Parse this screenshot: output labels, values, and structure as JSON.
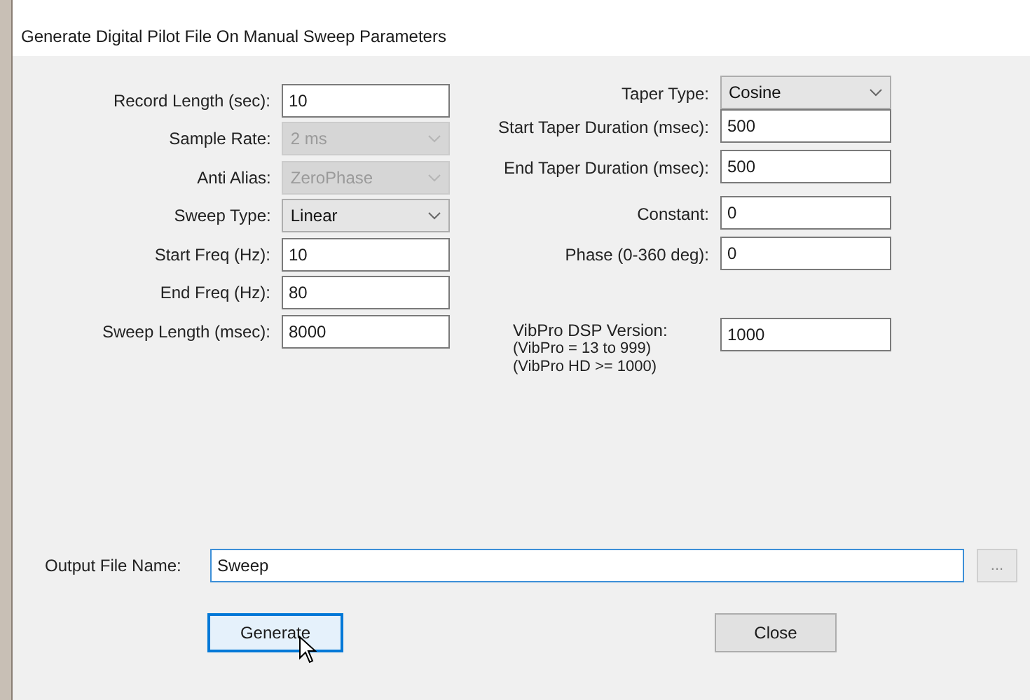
{
  "window": {
    "title": "Generate Digital Pilot File On Manual Sweep Parameters"
  },
  "left_fields": [
    {
      "label": "Record Length (sec):",
      "value": "10",
      "kind": "input",
      "disabled": false
    },
    {
      "label": "Sample Rate:",
      "value": "2 ms",
      "kind": "dropdown",
      "disabled": true
    },
    {
      "label": "Anti Alias:",
      "value": "ZeroPhase",
      "kind": "dropdown",
      "disabled": true
    },
    {
      "label": "Sweep Type:",
      "value": "Linear",
      "kind": "dropdown",
      "disabled": false
    },
    {
      "label": "Start Freq (Hz):",
      "value": "10",
      "kind": "input",
      "disabled": false
    },
    {
      "label": "End Freq (Hz):",
      "value": "80",
      "kind": "input",
      "disabled": false
    },
    {
      "label": "Sweep Length (msec):",
      "value": "8000",
      "kind": "input",
      "disabled": false
    }
  ],
  "right_fields": [
    {
      "label": "Taper Type:",
      "value": "Cosine",
      "kind": "dropdown",
      "disabled": false
    },
    {
      "label": "Start Taper Duration (msec):",
      "value": "500",
      "kind": "input",
      "disabled": false
    },
    {
      "label": "End Taper Duration (msec):",
      "value": "500",
      "kind": "input",
      "disabled": false
    },
    {
      "label": "Constant:",
      "value": "0",
      "kind": "input",
      "disabled": false
    },
    {
      "label": "Phase (0-360 deg):",
      "value": "0",
      "kind": "input",
      "disabled": false
    },
    {
      "label": "VibPro DSP Version:",
      "notes": [
        "(VibPro = 13 to 999)",
        "(VibPro HD >= 1000)"
      ],
      "value": "1000",
      "kind": "input",
      "disabled": false
    }
  ],
  "output": {
    "label": "Output File Name:",
    "value": "Sweep",
    "browse": "..."
  },
  "buttons": [
    {
      "label": "Generate",
      "focused": true
    },
    {
      "label": "Close",
      "focused": false
    }
  ]
}
